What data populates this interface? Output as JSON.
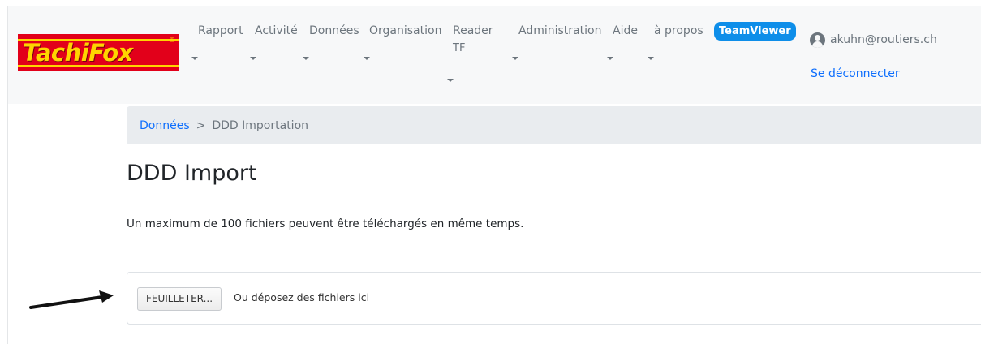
{
  "header": {
    "logo_text": "TachiFox",
    "logo_reg": "®",
    "nav": [
      {
        "label": "Rapport"
      },
      {
        "label": "Activité"
      },
      {
        "label": "Données"
      },
      {
        "label": "Organisation"
      },
      {
        "label_line1": "Reader",
        "label_line2": "TF"
      },
      {
        "label": "Administration"
      },
      {
        "label": "Aide"
      },
      {
        "label": "à propos"
      }
    ],
    "teamviewer": "TeamViewer",
    "user_email": "akuhn@routiers.ch",
    "logout": "Se déconnecter"
  },
  "breadcrumb": {
    "parent": "Données",
    "separator": ">",
    "current": "DDD Importation"
  },
  "main": {
    "title": "DDD Import",
    "info": "Un maximum de 100 fichiers peuvent être téléchargés en même temps.",
    "browse_label": "FEUILLETER...",
    "drop_hint": "Ou déposez des fichiers ici"
  },
  "colors": {
    "brand_red": "#e2001a",
    "brand_yellow": "#ffd400",
    "link_blue": "#0d6efd",
    "teamviewer_blue": "#0e8ee9"
  }
}
